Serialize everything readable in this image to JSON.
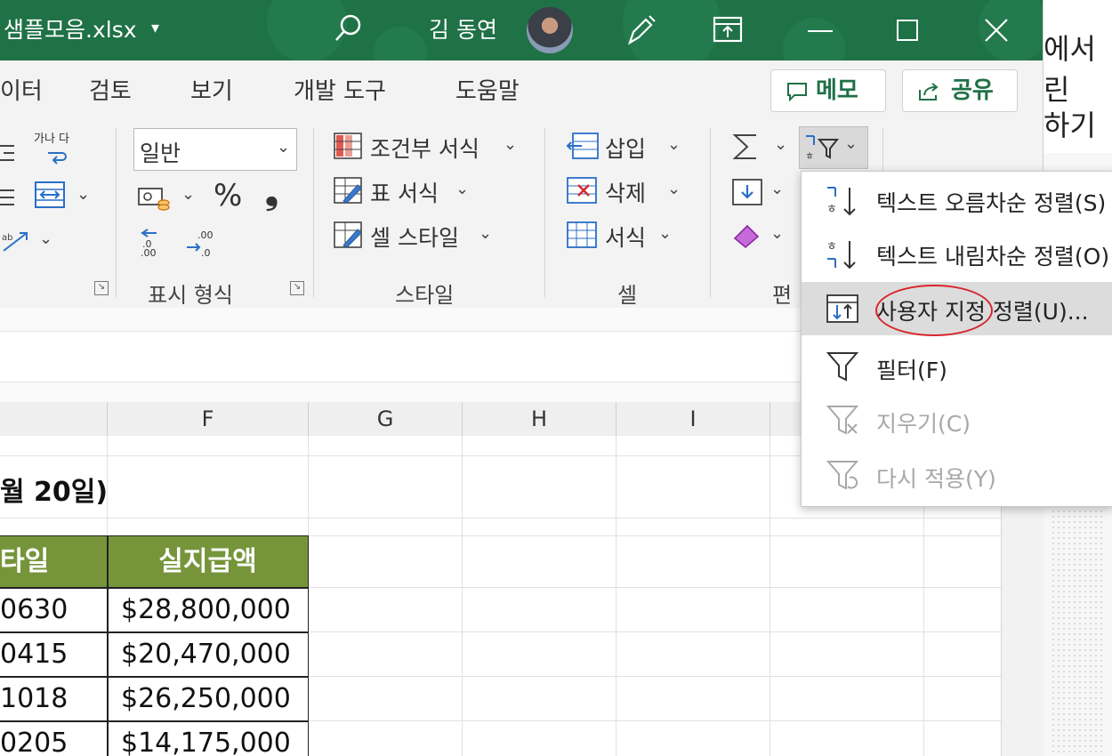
{
  "window": {
    "title": "샘플모음.xlsx",
    "user_name": "김 동연"
  },
  "ribbon": {
    "tabs": [
      "이터",
      "검토",
      "보기",
      "개발 도구",
      "도움말"
    ],
    "memo_label": "메모",
    "share_label": "공유",
    "number_format_value": "일반",
    "percent_symbol": "%",
    "comma_symbol": "❟",
    "styles": {
      "conditional": "조건부 서식",
      "table": "표 서식",
      "cell": "셀 스타일"
    },
    "cells": {
      "insert": "삽입",
      "delete": "삭제",
      "format": "서식"
    },
    "group_labels": {
      "number": "표시 형식",
      "styles": "스타일",
      "cells": "셀",
      "editing": "편"
    },
    "align_glyph": "가나 다"
  },
  "sort_filter_menu": {
    "items": [
      {
        "label": "텍스트 오름차순 정렬(S)",
        "icon": "sort-ascending-icon",
        "enabled": true
      },
      {
        "label": "텍스트 내림차순 정렬(O)",
        "icon": "sort-descending-icon",
        "enabled": true
      },
      {
        "label": "사용자 지정 정렬(U)...",
        "icon": "custom-sort-icon",
        "enabled": true,
        "highlighted": true
      },
      {
        "label": "필터(F)",
        "icon": "filter-icon",
        "enabled": true
      },
      {
        "label": "지우기(C)",
        "icon": "clear-filter-icon",
        "enabled": false
      },
      {
        "label": "다시 적용(Y)",
        "icon": "reapply-filter-icon",
        "enabled": false
      }
    ]
  },
  "sheet": {
    "columns": [
      "F",
      "G",
      "H",
      "I"
    ],
    "title_fragment": "월 20일)",
    "table_headers": [
      "타일",
      "실지급액"
    ],
    "rows": [
      [
        "0630",
        "$28,800,000"
      ],
      [
        "0415",
        "$20,470,000"
      ],
      [
        "1018",
        "$26,250,000"
      ],
      [
        "0205",
        "$14,175,000"
      ]
    ],
    "header_color": "#76953b"
  },
  "side_doc": {
    "lines": [
      "에서",
      "린",
      "하기"
    ]
  },
  "colors": {
    "title_bar": "#1f7146",
    "accent_green": "#1f7146",
    "annotation_red": "#d8252c"
  }
}
